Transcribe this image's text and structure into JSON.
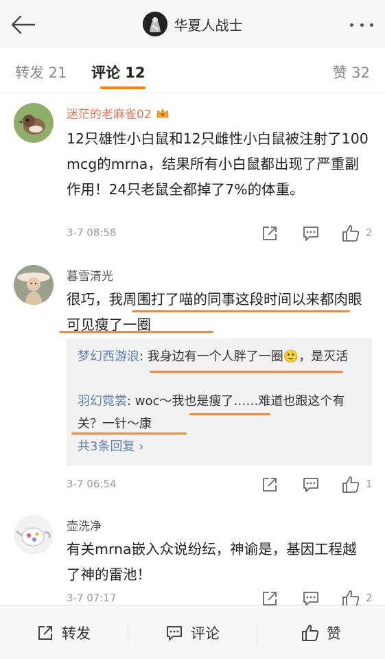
{
  "header": {
    "title": "华夏人战士",
    "back_icon": "back-arrow-icon",
    "more_icon": "more-dots-icon"
  },
  "tabs": [
    {
      "label": "转发 21"
    },
    {
      "label": "评论 12"
    },
    {
      "label": "赞 32"
    }
  ],
  "colors": {
    "accent": "#ff8200",
    "link": "#5d7fb4",
    "vip_name": "#eb7350",
    "highlight_mark": "#f08a3c"
  },
  "comments": [
    {
      "user": "迷茫的老麻雀02",
      "text": "12只雄性小白鼠和12只雌性小白鼠被注射了100 mcg的mrna，结果所有小白鼠都出现了严重副作用！24只老鼠全都掉了7%的体重。",
      "time": "3-7 08:58",
      "likes": "2"
    },
    {
      "user": "暮雪清光",
      "text": "很巧，我周围打了喵的同事这段时间以来都肉眼可见瘦了一圈",
      "time": "3-7 06:54",
      "likes": "1",
      "replies": [
        {
          "nick": "梦幻西游浪",
          "text": ": 我身边有一个人胖了一圈🙂，是灭活"
        },
        {
          "nick": "羽幻霓裳",
          "text": ": woc～我也是瘦了……难道也跟这个有关？一针～康"
        }
      ],
      "more_replies": "共3条回复 ›"
    },
    {
      "user": "壶洗净",
      "text": "有关mrna嵌入众说纷纭，神谕是，基因工程越了神的雷池！",
      "time": "3-7 07:17",
      "likes": "2"
    }
  ],
  "bottom_bar": {
    "repost": "转发",
    "comment": "评论",
    "like": "赞"
  }
}
